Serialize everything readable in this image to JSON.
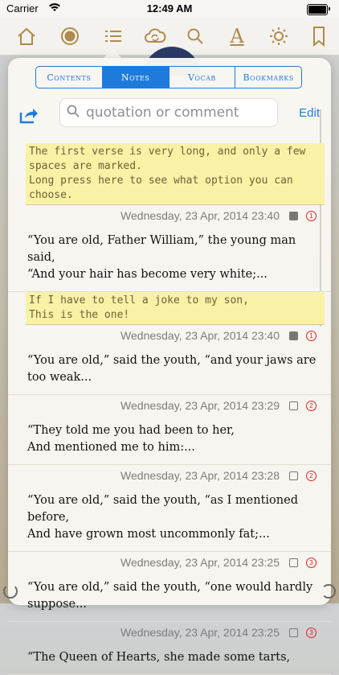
{
  "status_bar": {
    "carrier": "Carrier",
    "time": "12:49 AM"
  },
  "toolbar": {
    "icons": [
      "home-icon",
      "record-icon",
      "list-icon",
      "cloud-sync-icon",
      "search-icon",
      "font-icon",
      "brightness-icon",
      "bookmark-icon"
    ],
    "font_glyph": "A"
  },
  "tabs": [
    {
      "label": "Contents",
      "active": false
    },
    {
      "label": "Notes",
      "active": true
    },
    {
      "label": "Vocab",
      "active": false
    },
    {
      "label": "Bookmarks",
      "active": false
    }
  ],
  "search": {
    "placeholder": "quotation or comment",
    "value": ""
  },
  "edit_label": "Edit",
  "accent_color": "#1e7bdc",
  "notes": [
    {
      "comment": "The first verse is very long, and only a few spaces are marked.\nLong press here to see what option you can choose.",
      "date": "Wednesday, 23 Apr, 2014 23:40",
      "checked": true,
      "count": "1",
      "quote": "“You are old, Father William,” the young man said,\n    “And your hair has become very white;..."
    },
    {
      "comment": "If I have to tell a joke to my son,\n  This is the one!",
      "date": "Wednesday, 23 Apr, 2014 23:40",
      "checked": true,
      "count": "1",
      "quote": "“You are old,” said the youth, “and your jaws are too weak..."
    },
    {
      "comment": "",
      "date": "Wednesday, 23 Apr, 2014 23:29",
      "checked": false,
      "count": "2",
      "quote": "“They told me you had been to her,\n    And mentioned me to him:..."
    },
    {
      "comment": "",
      "date": "Wednesday, 23 Apr, 2014 23:28",
      "checked": false,
      "count": "2",
      "quote": "“You are old,” said the youth, “as I mentioned before,\n    And have grown most uncommonly fat;..."
    },
    {
      "comment": "",
      "date": "Wednesday, 23 Apr, 2014 23:25",
      "checked": false,
      "count": "3",
      "quote": "“You are old,” said the youth, “one would hardly suppose..."
    },
    {
      "comment": "",
      "date": "Wednesday, 23 Apr, 2014 23:25",
      "checked": false,
      "count": "3",
      "quote": "“The Queen of Hearts, she made some tarts,"
    }
  ]
}
